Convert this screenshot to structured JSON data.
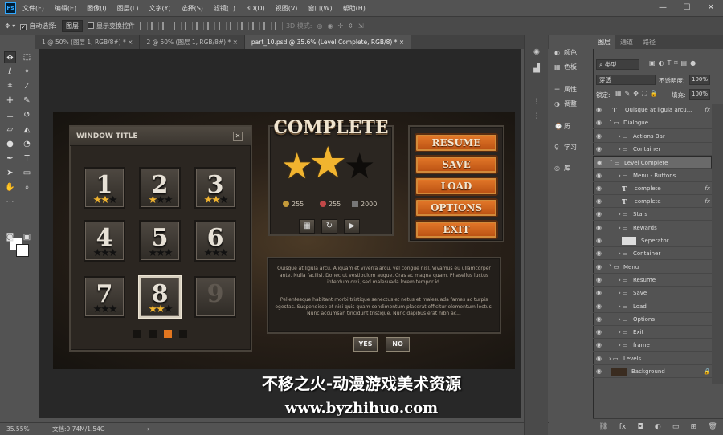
{
  "menubar": {
    "logo": "Ps",
    "items": [
      "文件(F)",
      "编辑(E)",
      "图像(I)",
      "图层(L)",
      "文字(Y)",
      "选择(S)",
      "滤镜(T)",
      "3D(D)",
      "视图(V)",
      "窗口(W)",
      "帮助(H)"
    ],
    "window_controls": [
      "—",
      "☐",
      "✕"
    ]
  },
  "options_bar": {
    "auto_select_label": "自动选择:",
    "auto_select_value": "图层",
    "show_transform_label": "显示变换控件",
    "mode_3d_label": "3D 模式:"
  },
  "tabs": [
    {
      "label": "1 @ 50% (图层 1, RGB/8#) *",
      "close": "×"
    },
    {
      "label": "2 @ 50% (图层 1, RGB/8#) *",
      "close": "×"
    },
    {
      "label": "part_10.psd @ 35.6% (Level Complete, RGB/8) *",
      "close": "×"
    }
  ],
  "document": {
    "window_title": "WINDOW TITLE",
    "close_glyph": "✕",
    "levels": [
      {
        "n": "1",
        "stars": 2
      },
      {
        "n": "2",
        "stars": 1
      },
      {
        "n": "3",
        "stars": 2
      },
      {
        "n": "4",
        "stars": 0
      },
      {
        "n": "5",
        "stars": 0
      },
      {
        "n": "6",
        "stars": 0
      },
      {
        "n": "7",
        "stars": 0
      },
      {
        "n": "8",
        "stars": 2
      },
      {
        "n": "9",
        "stars": 0
      }
    ],
    "complete_title": "COMPLETE",
    "rewards": [
      "255",
      "255",
      "2000"
    ],
    "small_buttons": [
      "▦",
      "↻",
      "▶"
    ],
    "menu_buttons": [
      "RESUME",
      "SAVE",
      "LOAD",
      "OPTIONS",
      "EXIT"
    ],
    "paragraph_1": "Quisque at ligula arcu. Aliquam et viverra arcu, vel congue nisl. Vivamus eu ullamcorper ante. Nulla facilisi. Donec ut vestibulum augue. Cras ac magna quam. Phasellus luctus interdum orci, sed malesuada lorem tempor id.",
    "paragraph_2": "Pellentesque habitant morbi tristique senectus et netus et malesuada fames ac turpis egestas. Suspendisse et nisi quis quam condimentum placerat efficitur elementum lectus. Nunc accumsan tincidunt tristique. Nunc dapibus erat nibh ac...",
    "yes_label": "YES",
    "no_label": "NO"
  },
  "watermark": {
    "line1": "不移之火-动漫游戏美术资源",
    "line2": "www.byzhihuo.com"
  },
  "status": {
    "zoom": "35.55%",
    "doc": "文档:9.74M/1.54G",
    "arrow": "›"
  },
  "dock": {
    "items": [
      {
        "icon": "◐",
        "label": "颜色"
      },
      {
        "icon": "▦",
        "label": "色板"
      },
      {
        "icon": "☰",
        "label": "属性"
      },
      {
        "icon": "◑",
        "label": "调整"
      },
      {
        "icon": "⌚",
        "label": "历..."
      },
      {
        "icon": "♀",
        "label": "学习"
      },
      {
        "icon": "◎",
        "label": "库"
      }
    ]
  },
  "layers_panel": {
    "tabs": [
      "图层",
      "通道",
      "路径"
    ],
    "filter_label": "类型",
    "blend_mode": "穿透",
    "opacity_label": "不透明度:",
    "opacity_value": "100%",
    "lock_label": "锁定:",
    "fill_label": "填充:",
    "fill_value": "100%",
    "rows": [
      {
        "name": "Quisque at ligula arcu...",
        "kind": "text",
        "indent": 1,
        "fx": "fx"
      },
      {
        "name": "Dialogue",
        "kind": "group-open",
        "indent": 1,
        "fx": ""
      },
      {
        "name": "Actions Bar",
        "kind": "group",
        "indent": 2,
        "fx": ""
      },
      {
        "name": "Container",
        "kind": "group",
        "indent": 2,
        "fx": ""
      },
      {
        "name": "Level Complete",
        "kind": "group-open",
        "indent": 1,
        "fx": ""
      },
      {
        "name": "Menu - Buttons",
        "kind": "group",
        "indent": 2,
        "fx": ""
      },
      {
        "name": "complete",
        "kind": "text",
        "indent": 2,
        "fx": "fx"
      },
      {
        "name": "complete",
        "kind": "text",
        "indent": 2,
        "fx": "fx"
      },
      {
        "name": "Stars",
        "kind": "group",
        "indent": 2,
        "fx": ""
      },
      {
        "name": "Rewards",
        "kind": "group",
        "indent": 2,
        "fx": ""
      },
      {
        "name": "Seperator",
        "kind": "image",
        "indent": 2,
        "fx": ""
      },
      {
        "name": "Container",
        "kind": "group",
        "indent": 2,
        "fx": ""
      },
      {
        "name": "Menu",
        "kind": "group-open",
        "indent": 1,
        "fx": ""
      },
      {
        "name": "Resume",
        "kind": "group",
        "indent": 2,
        "fx": ""
      },
      {
        "name": "Save",
        "kind": "group",
        "indent": 2,
        "fx": ""
      },
      {
        "name": "Load",
        "kind": "group",
        "indent": 2,
        "fx": ""
      },
      {
        "name": "Options",
        "kind": "group",
        "indent": 2,
        "fx": ""
      },
      {
        "name": "Exit",
        "kind": "group",
        "indent": 2,
        "fx": ""
      },
      {
        "name": "frame",
        "kind": "group",
        "indent": 2,
        "fx": ""
      },
      {
        "name": "Levels",
        "kind": "group",
        "indent": 1,
        "fx": ""
      },
      {
        "name": "Background",
        "kind": "bg",
        "indent": 1,
        "fx": ""
      }
    ],
    "footer_icons": [
      "⛓",
      "fx",
      "◘",
      "◐",
      "▭",
      "⊞",
      "🗑"
    ]
  },
  "colors": {
    "accent_orange": "#e2761f",
    "star_gold": "#f1b42f",
    "selected_layer": "#6a6a6a"
  }
}
